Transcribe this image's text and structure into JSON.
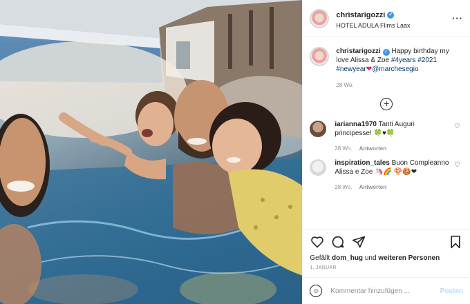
{
  "post": {
    "username": "christarigozzi",
    "location": "HOTEL ADULA Flims Laax",
    "more_icon": "more-horizontal-icon",
    "verified_icon": "verified-badge-icon"
  },
  "caption": {
    "username": "christarigozzi",
    "text_1": "Happy birthday my love Alissa & Zoe",
    "tag_1": "#4years",
    "tag_2": "#2021",
    "tag_3": "#newyear",
    "emoji": "❤",
    "mention": "@marchesegio",
    "age": "28 Wo."
  },
  "load_more_icon": "plus-circle-icon",
  "comments": [
    {
      "username": "iarianna1970",
      "text": "Tanti Auguri principesse! 🍀♥🍀",
      "age": "28 Wo.",
      "reply": "Antworten"
    },
    {
      "username": "inspiration_tales",
      "text": "Buon Compleanno Alissa e Zoe 🦄🌈 🍄🍪❤",
      "age": "28 Wo.",
      "reply": "Antworten"
    }
  ],
  "actions": {
    "like_icon": "heart-icon",
    "comment_icon": "comment-icon",
    "share_icon": "share-icon",
    "save_icon": "bookmark-icon"
  },
  "likes": {
    "prefix": "Gefällt",
    "user": "dom_hug",
    "middle": "und",
    "others": "weiteren Personen"
  },
  "date": "1. JANUAR",
  "add_comment": {
    "emoji_icon": "emoji-icon",
    "placeholder": "Kommentar hinzufügen ...",
    "post_label": "Posten"
  },
  "colors": {
    "link": "#00376b",
    "verified": "#3897f0",
    "post_button_disabled": "#b2dffc",
    "muted": "#8e8e8e"
  }
}
